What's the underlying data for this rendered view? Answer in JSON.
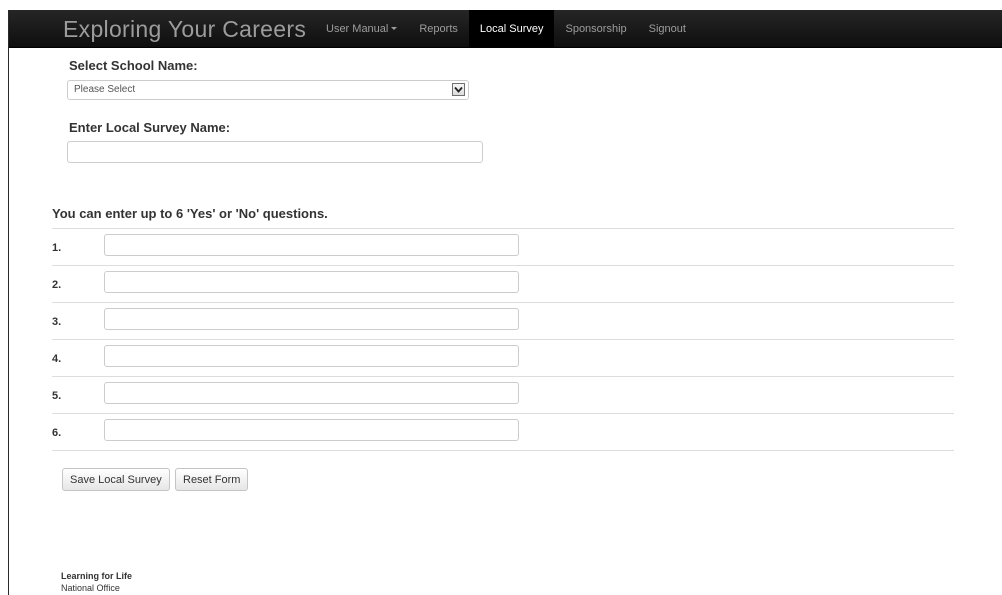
{
  "navbar": {
    "brand": "Exploring Your Careers",
    "items": [
      {
        "label": "User Manual",
        "has_dropdown": true,
        "active": false
      },
      {
        "label": "Reports",
        "has_dropdown": false,
        "active": false
      },
      {
        "label": "Local Survey",
        "has_dropdown": false,
        "active": true
      },
      {
        "label": "Sponsorship",
        "has_dropdown": false,
        "active": false
      },
      {
        "label": "Signout",
        "has_dropdown": false,
        "active": false
      }
    ]
  },
  "form": {
    "school_label": "Select School Name:",
    "school_select_value": "Please Select",
    "survey_name_label": "Enter Local Survey Name:",
    "survey_name_value": "",
    "questions_heading": "You can enter up to 6 'Yes' or 'No' questions.",
    "questions": [
      {
        "number": "1.",
        "value": ""
      },
      {
        "number": "2.",
        "value": ""
      },
      {
        "number": "3.",
        "value": ""
      },
      {
        "number": "4.",
        "value": ""
      },
      {
        "number": "5.",
        "value": ""
      },
      {
        "number": "6.",
        "value": ""
      }
    ],
    "save_button": "Save Local Survey",
    "reset_button": "Reset Form"
  },
  "footer": {
    "org_name": "Learning for Life",
    "office": "National Office"
  },
  "colors": {
    "navbar_bg": "#1a1a1a",
    "nav_active_bg": "#000000",
    "nav_text": "#9d9d9d",
    "border": "#cccccc"
  }
}
